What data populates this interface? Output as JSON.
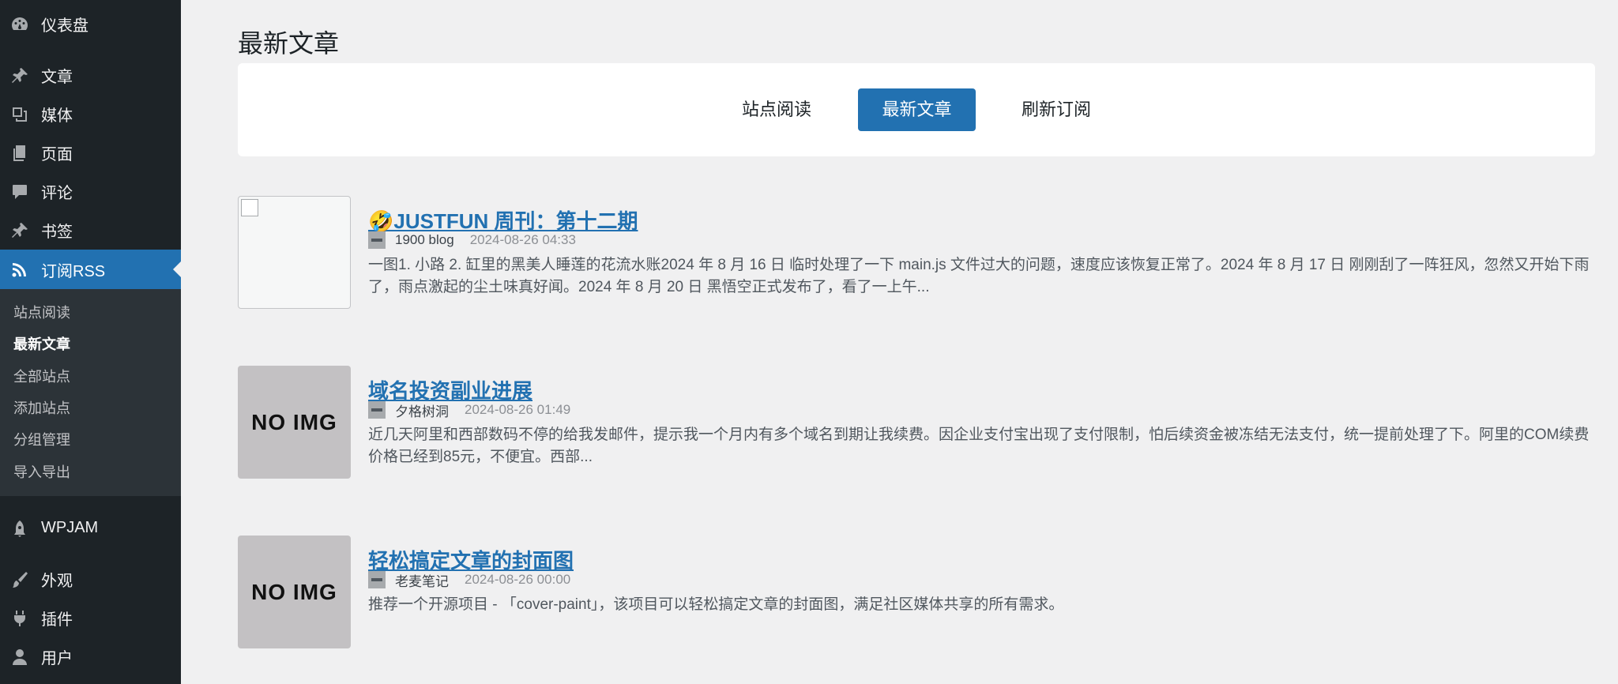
{
  "sidebar": {
    "items": [
      {
        "label": "仪表盘",
        "icon": "dashboard-icon"
      },
      {
        "label": "文章",
        "icon": "pin-icon"
      },
      {
        "label": "媒体",
        "icon": "media-icon"
      },
      {
        "label": "页面",
        "icon": "page-icon"
      },
      {
        "label": "评论",
        "icon": "comment-icon"
      },
      {
        "label": "书签",
        "icon": "pin-icon"
      },
      {
        "label": "订阅RSS",
        "icon": "rss-icon"
      },
      {
        "label": "WPJAM",
        "icon": "rocket-icon"
      },
      {
        "label": "外观",
        "icon": "brush-icon"
      },
      {
        "label": "插件",
        "icon": "plugin-icon"
      },
      {
        "label": "用户",
        "icon": "user-icon"
      }
    ],
    "submenu": [
      {
        "label": "站点阅读"
      },
      {
        "label": "最新文章"
      },
      {
        "label": "全部站点"
      },
      {
        "label": "添加站点"
      },
      {
        "label": "分组管理"
      },
      {
        "label": "导入导出"
      }
    ]
  },
  "page": {
    "title": "最新文章",
    "tabs": [
      {
        "label": "站点阅读"
      },
      {
        "label": "最新文章"
      },
      {
        "label": "刷新订阅"
      }
    ]
  },
  "articles": [
    {
      "title": "🤣JUSTFUN 周刊：第十二期",
      "source": "1900 blog",
      "date": "2024-08-26 04:33",
      "excerpt": "一图1. 小路 2. 缸里的黑美人睡莲的花流水账2024 年 8 月 16 日 临时处理了一下 main.js 文件过大的问题，速度应该恢复正常了。2024 年 8 月 17 日 刚刚刮了一阵狂风，忽然又开始下雨了，雨点激起的尘土味真好闻。2024 年 8 月 20 日 黑悟空正式发布了，看了一上午..."
    },
    {
      "title": "域名投资副业进展",
      "source": "夕格树洞",
      "date": "2024-08-26 01:49",
      "thumb_text": "NO  IMG",
      "excerpt": "近几天阿里和西部数码不停的给我发邮件，提示我一个月内有多个域名到期让我续费。因企业支付宝出现了支付限制，怕后续资金被冻结无法支付，统一提前处理了下。阿里的COM续费价格已经到85元，不便宜。西部..."
    },
    {
      "title": "轻松搞定文章的封面图",
      "source": "老麦笔记",
      "date": "2024-08-26 00:00",
      "thumb_text": "NO  IMG",
      "excerpt": "推荐一个开源项目 - 「cover-paint」，该项目可以轻松搞定文章的封面图，满足社区媒体共享的所有需求。"
    }
  ],
  "colors": {
    "sidebar_bg": "#1d2327",
    "submenu_bg": "#2c3338",
    "accent": "#2271b1",
    "page_bg": "#f0f0f1"
  }
}
